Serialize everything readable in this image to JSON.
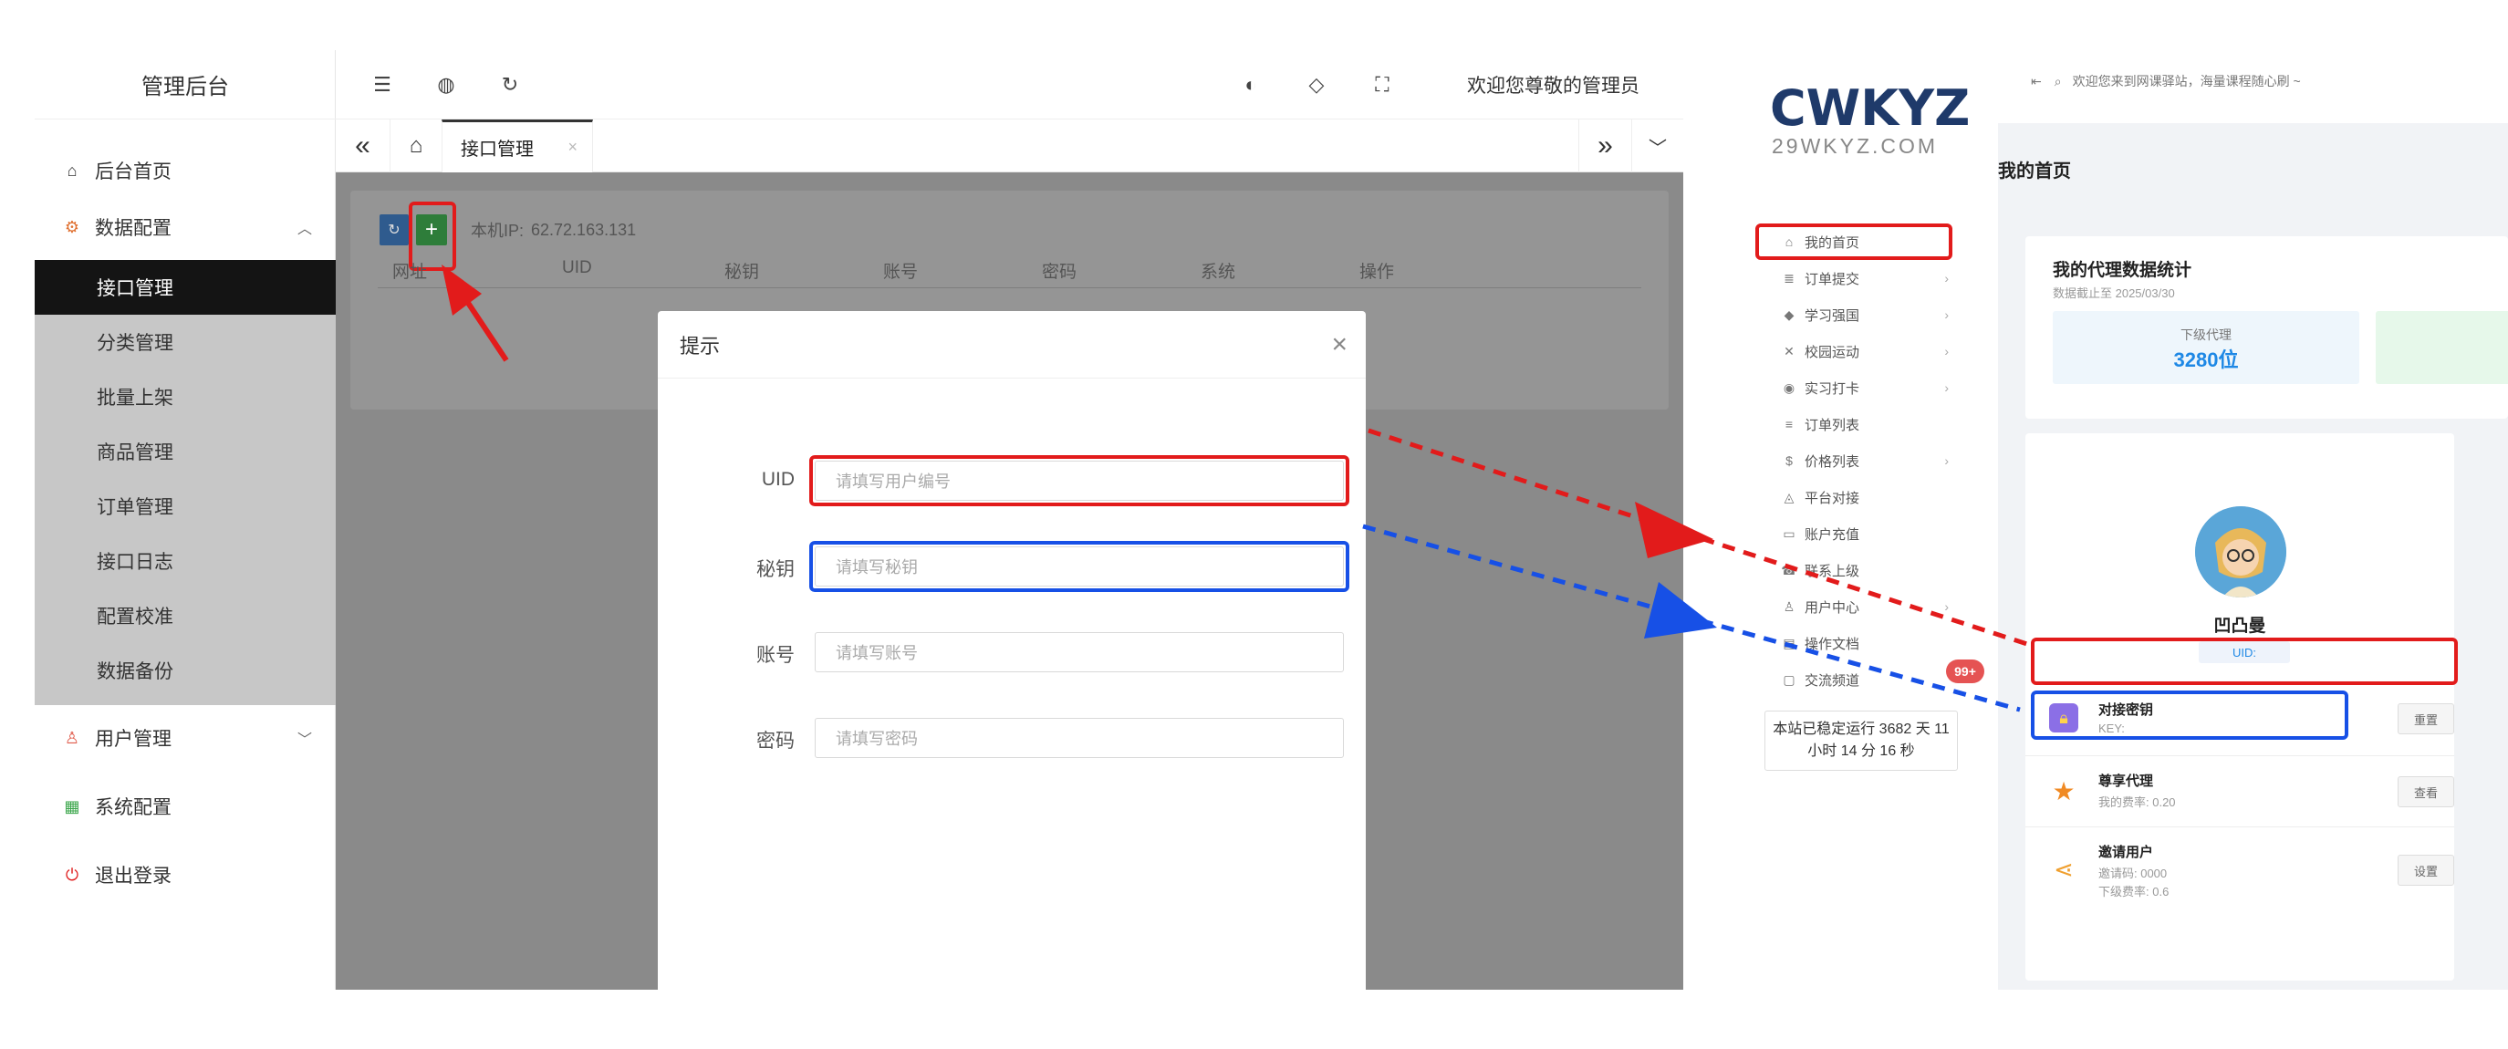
{
  "admin": {
    "logo": "管理后台",
    "menu": {
      "home": "后台首页",
      "data_config": "数据配置",
      "sub_items": [
        "接口管理",
        "分类管理",
        "批量上架",
        "商品管理",
        "订单管理",
        "接口日志",
        "配置校准",
        "数据备份"
      ],
      "user_mgmt": "用户管理",
      "sys_config": "系统配置",
      "logout": "退出登录"
    },
    "header": {
      "welcome": "欢迎您尊敬的管理员"
    },
    "tabs": {
      "active": "接口管理"
    },
    "content": {
      "ip_label": "本机IP:",
      "ip_value": "62.72.163.131",
      "columns": [
        "网址",
        "UID",
        "秘钥",
        "账号",
        "密码",
        "系统",
        "操作"
      ]
    },
    "modal": {
      "title": "提示",
      "fields": [
        {
          "label": "UID",
          "placeholder": "请填写用户编号"
        },
        {
          "label": "秘钥",
          "placeholder": "请填写秘钥"
        },
        {
          "label": "账号",
          "placeholder": "请填写账号"
        },
        {
          "label": "密码",
          "placeholder": "请填写密码"
        }
      ]
    }
  },
  "site": {
    "logo_text": "WKYZ",
    "logo_domain": "29WKYZ.COM",
    "topbar_notice": "欢迎您来到网课驿站，海量课程随心刷 ~",
    "nav": [
      {
        "label": "我的首页",
        "icon": "home-icon",
        "arrow": false
      },
      {
        "label": "订单提交",
        "icon": "list-icon",
        "arrow": true
      },
      {
        "label": "学习强国",
        "icon": "graduation-icon",
        "arrow": true
      },
      {
        "label": "校园运动",
        "icon": "tools-icon",
        "arrow": true
      },
      {
        "label": "实习打卡",
        "icon": "location-icon",
        "arrow": true
      },
      {
        "label": "订单列表",
        "icon": "orders-icon",
        "arrow": false
      },
      {
        "label": "价格列表",
        "icon": "dollar-icon",
        "arrow": true
      },
      {
        "label": "平台对接",
        "icon": "link-icon",
        "arrow": false
      },
      {
        "label": "账户充值",
        "icon": "card-icon",
        "arrow": false
      },
      {
        "label": "联系上级",
        "icon": "contact-icon",
        "arrow": false
      },
      {
        "label": "用户中心",
        "icon": "user-icon",
        "arrow": true
      },
      {
        "label": "操作文档",
        "icon": "docs-icon",
        "arrow": false
      },
      {
        "label": "交流频道",
        "icon": "chat-icon",
        "arrow": false
      }
    ],
    "chat_badge": "99+",
    "uptime": "本站已稳定运行 3682 天 11 小时 14 分 16 秒",
    "page_title": "我的首页",
    "stats": {
      "title": "我的代理数据统计",
      "subtitle": "数据截止至 2025/03/30",
      "sub_agent_label": "下级代理",
      "sub_agent_value": "3280位"
    },
    "profile": {
      "name": "凹凸曼",
      "uid_label": "UID:",
      "rows": [
        {
          "title": "对接密钥",
          "line1": "KEY:",
          "line2": "",
          "button": "重置"
        },
        {
          "title": "尊享代理",
          "line1": "我的费率: 0.20",
          "line2": "",
          "button": "查看"
        },
        {
          "title": "邀请用户",
          "line1": "邀请码: 0000",
          "line2": "下级费率: 0.6",
          "button": "设置"
        }
      ]
    }
  },
  "colors": {
    "annotation_red": "#e21b1b",
    "annotation_blue": "#1750e6",
    "admin_active": "#141414",
    "accent_blue": "#1e88e5"
  }
}
